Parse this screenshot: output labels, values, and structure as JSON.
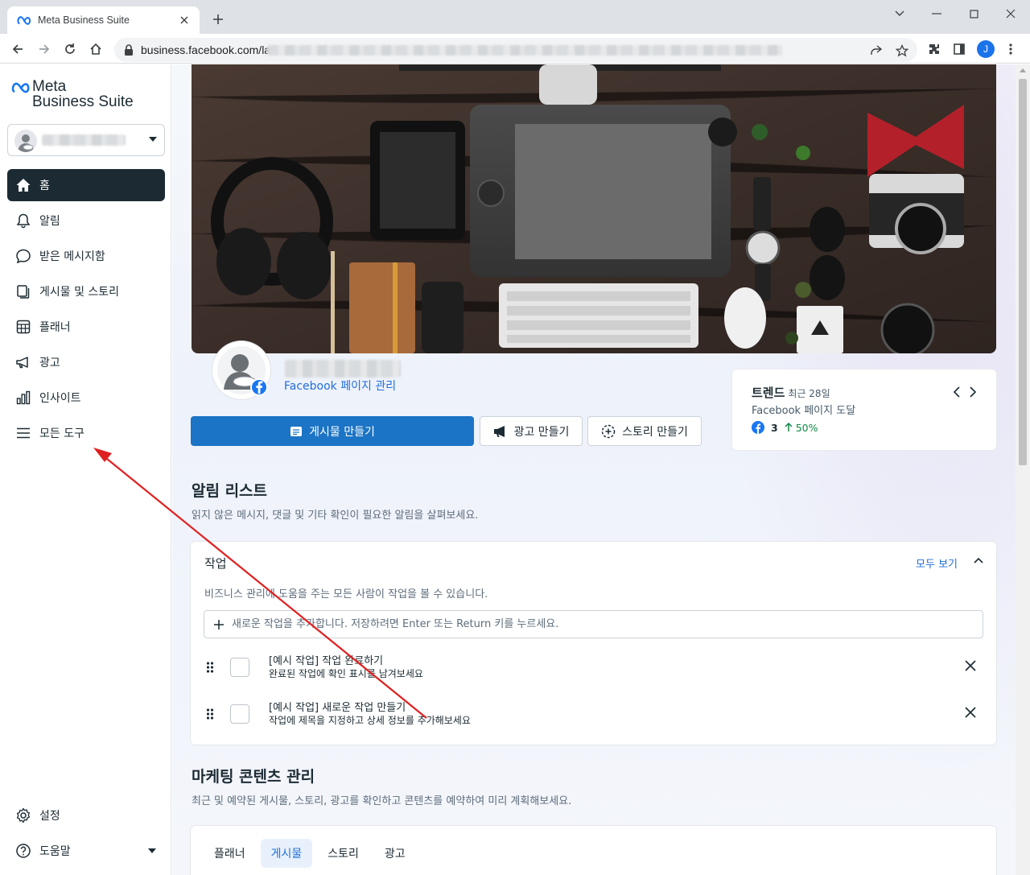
{
  "browser": {
    "tab_title": "Meta Business Suite",
    "url_visible": "business.facebook.com/la",
    "profile_initial": "J"
  },
  "sidebar": {
    "brand_line1": "Meta",
    "brand_line2": "Business Suite",
    "nav": [
      {
        "label": "홈",
        "icon": "home-icon"
      },
      {
        "label": "알림",
        "icon": "bell-icon"
      },
      {
        "label": "받은 메시지함",
        "icon": "chat-icon"
      },
      {
        "label": "게시물 및 스토리",
        "icon": "posts-icon"
      },
      {
        "label": "플래너",
        "icon": "calendar-icon"
      },
      {
        "label": "광고",
        "icon": "megaphone-icon"
      },
      {
        "label": "인사이트",
        "icon": "bar-chart-icon"
      },
      {
        "label": "모든 도구",
        "icon": "menu-icon"
      }
    ],
    "bottom": [
      {
        "label": "설정",
        "icon": "gear-icon"
      },
      {
        "label": "도움말",
        "icon": "help-icon"
      }
    ]
  },
  "page": {
    "manage_link": "Facebook 페이지 관리"
  },
  "actions": {
    "create_post": "게시물 만들기",
    "create_ad": "광고 만들기",
    "create_story": "스토리 만들기"
  },
  "trend": {
    "title": "트렌드",
    "period": "최근 28일",
    "subtitle": "Facebook 페이지 도달",
    "count": "3",
    "change": "50%"
  },
  "alerts": {
    "title": "알림 리스트",
    "subtitle": "읽지 않은 메시지, 댓글 및 기타 확인이 필요한 알림을 살펴보세요."
  },
  "tasks": {
    "title": "작업",
    "see_all": "모두 보기",
    "description": "비즈니스 관리에 도움을 주는 모든 사람이 작업을 볼 수 있습니다.",
    "input_placeholder": "새로운 작업을 추가합니다. 저장하려면 Enter 또는 Return 키를 누르세요.",
    "items": [
      {
        "title": "[예시 작업] 작업 완료하기",
        "desc": "완료된 작업에 확인 표시를 남겨보세요"
      },
      {
        "title": "[예시 작업] 새로운 작업 만들기",
        "desc": "작업에 제목을 지정하고 상세 정보를 추가해보세요"
      }
    ]
  },
  "marketing": {
    "title": "마케팅 콘텐츠 관리",
    "subtitle": "최근 및 예약된 게시물, 스토리, 광고를 확인하고 콘텐츠를 예약하여 미리 계획해보세요.",
    "tabs": [
      "플래너",
      "게시물",
      "스토리",
      "광고"
    ],
    "active_tab": "게시물"
  },
  "colors": {
    "accent": "#1b74c5",
    "link": "#216fdb",
    "nav_active_bg": "#1c2b33",
    "trend_up": "#0f8a46",
    "annotation_arrow": "#e02020"
  }
}
